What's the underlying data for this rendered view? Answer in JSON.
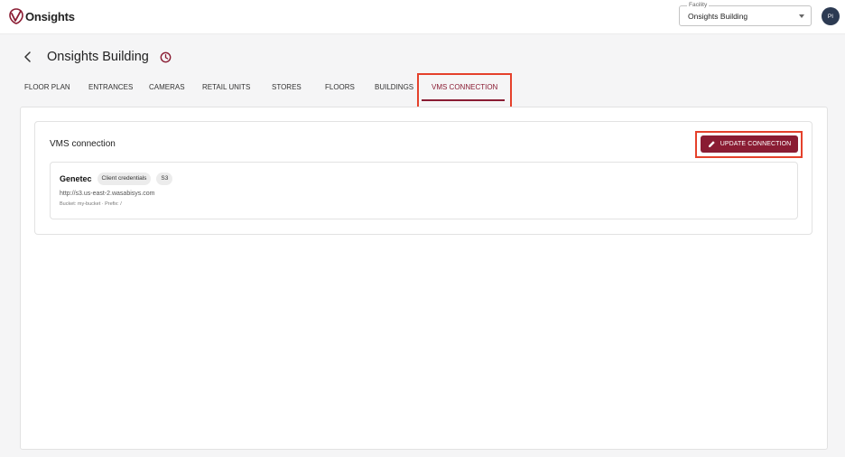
{
  "app": {
    "logo_text": "Onsights"
  },
  "facility": {
    "label": "Facility",
    "value": "Onsights Building"
  },
  "user": {
    "initials": "PI"
  },
  "page": {
    "title": "Onsights Building"
  },
  "tabs": [
    {
      "label": "FLOOR PLAN",
      "active": false
    },
    {
      "label": "ENTRANCES",
      "active": false
    },
    {
      "label": "CAMERAS",
      "active": false
    },
    {
      "label": "RETAIL UNITS",
      "active": false
    },
    {
      "label": "STORES",
      "active": false
    },
    {
      "label": "FLOORS",
      "active": false
    },
    {
      "label": "BUILDINGS",
      "active": false
    },
    {
      "label": "VMS CONNECTION",
      "active": true
    }
  ],
  "vms": {
    "section_title": "VMS connection",
    "update_button": "UPDATE CONNECTION",
    "connection": {
      "name": "Genetec",
      "chips": [
        "Client credentials",
        "S3"
      ],
      "url": "http://s3.us-east-2.wasabisys.com",
      "bucket_line": "Bucket: my-bucket · Prefix: /"
    }
  },
  "colors": {
    "brand": "#8a1c33",
    "highlight": "#e5412b",
    "avatar_bg": "#2c3a52"
  },
  "icons": {
    "logo": "onsights-logo-icon",
    "back": "chevron-left-icon",
    "history": "clock-history-icon",
    "edit": "pencil-icon",
    "dropdown": "caret-down-icon"
  }
}
